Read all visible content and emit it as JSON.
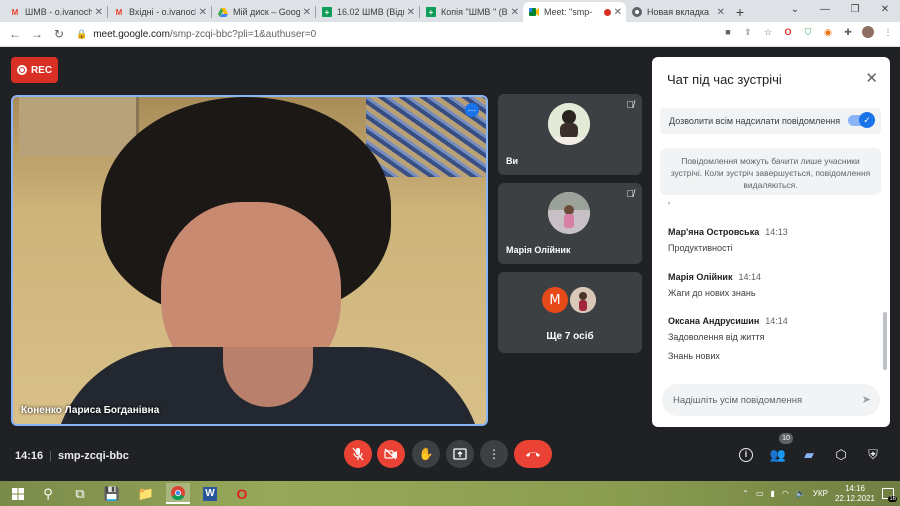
{
  "browser": {
    "tabs": [
      {
        "title": "ШМВ - o.ivanoch",
        "icon": "gmail-icon",
        "active": false
      },
      {
        "title": "Вхідні - o.ivanoch",
        "icon": "gmail-icon",
        "active": false
      },
      {
        "title": "Мій диск – Goog",
        "icon": "google-drive-icon",
        "active": false
      },
      {
        "title": "16.02 ШМВ (Відп",
        "icon": "google-sheets-icon",
        "active": false
      },
      {
        "title": "Копія \"ШМВ \" (В",
        "icon": "google-sheets-icon",
        "active": false
      },
      {
        "title": "Meet: \"smp-",
        "icon": "google-meet-icon",
        "active": true,
        "recording": true
      },
      {
        "title": "Новая вкладка",
        "icon": "chrome-icon",
        "active": false
      }
    ],
    "url_host": "meet.google.com",
    "url_path": "/smp-zcqi-bbc?pli=1&authuser=0"
  },
  "meet": {
    "rec_label": "REC",
    "main_speaker_name": "Коненко Лариса Богданівна",
    "tiles": [
      {
        "name": "Ви",
        "muted": true
      },
      {
        "name": "Марія Олійник",
        "muted": true
      }
    ],
    "more_tile": {
      "initial": "M",
      "label": "Ще 7 осіб"
    },
    "time": "14:16",
    "meeting_code": "smp-zcqi-bbc",
    "participants_count": "10"
  },
  "chat": {
    "title": "Чат під час зустрічі",
    "allow_label": "Дозволити всім надсилати повідомлення",
    "notice": "Повідомлення можуть бачити лише учасники зустрічі. Коли зустріч завершується, повідомлення видаляються.",
    "messages": [
      {
        "sender": "Мар'яна Островська",
        "time": "14:13",
        "lines": [
          "Продуктивності"
        ]
      },
      {
        "sender": "Марія Олійник",
        "time": "14:14",
        "lines": [
          "Жаги до нових знань"
        ]
      },
      {
        "sender": "Оксана Андрусишин",
        "time": "14:14",
        "lines": [
          "Задоволення від життя",
          "Знань нових"
        ]
      }
    ],
    "input_placeholder": "Надішліть усім повідомлення"
  },
  "taskbar": {
    "language": "УКР",
    "time": "14:16",
    "date": "22.12.2021",
    "notification_count": "16"
  },
  "colors": {
    "meet_bg": "#202124",
    "accent": "#1a73e8",
    "danger": "#ea4335",
    "active_border": "#8ab4f8"
  }
}
